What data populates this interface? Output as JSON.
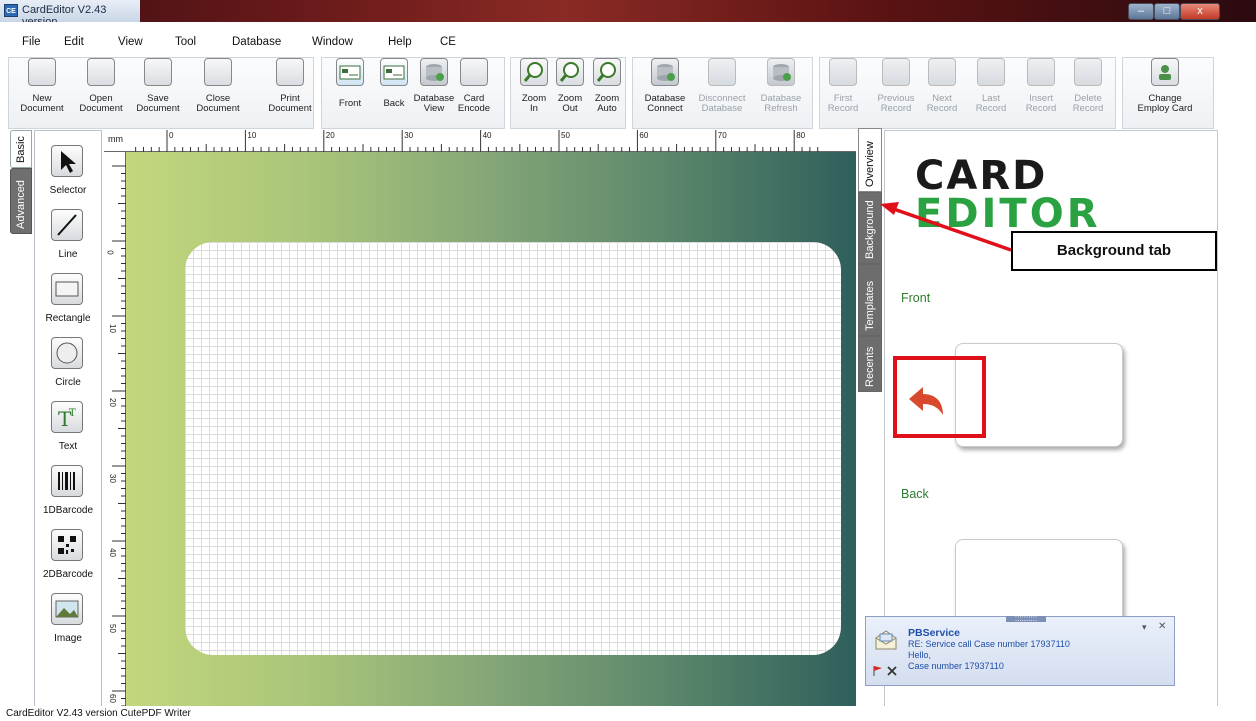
{
  "window": {
    "title": "CardEditor V2.43 version",
    "app_icon": "CE",
    "minimize": "–",
    "maximize": "□",
    "close": "x"
  },
  "menu": [
    "File",
    "Edit",
    "View",
    "Tool",
    "Database",
    "Window",
    "Help",
    "CE"
  ],
  "toolbar": [
    {
      "icon": "new-document-icon",
      "l1": "New",
      "l2": "Document",
      "enabled": true
    },
    {
      "icon": "open-document-icon",
      "l1": "Open",
      "l2": "Document",
      "enabled": true
    },
    {
      "icon": "save-document-icon",
      "l1": "Save",
      "l2": "Document",
      "enabled": true
    },
    {
      "icon": "close-document-icon",
      "l1": "Close",
      "l2": "Document",
      "enabled": true
    },
    {
      "icon": "print-document-icon",
      "l1": "Print",
      "l2": "Document",
      "enabled": true
    },
    {
      "icon": "front-card-icon",
      "l1": "Front",
      "l2": "",
      "enabled": true
    },
    {
      "icon": "back-card-icon",
      "l1": "Back",
      "l2": "",
      "enabled": true
    },
    {
      "icon": "database-view-icon",
      "l1": "Database",
      "l2": "View",
      "enabled": true
    },
    {
      "icon": "card-encode-icon",
      "l1": "Card",
      "l2": "Encode",
      "enabled": true
    },
    {
      "icon": "zoom-in-icon",
      "l1": "Zoom",
      "l2": "In",
      "enabled": true
    },
    {
      "icon": "zoom-out-icon",
      "l1": "Zoom",
      "l2": "Out",
      "enabled": true
    },
    {
      "icon": "zoom-auto-icon",
      "l1": "Zoom",
      "l2": "Auto",
      "enabled": true
    },
    {
      "icon": "database-connect-icon",
      "l1": "Database",
      "l2": "Connect",
      "enabled": true
    },
    {
      "icon": "disconnect-database-icon",
      "l1": "Disconnect",
      "l2": "Database",
      "enabled": false
    },
    {
      "icon": "database-refresh-icon",
      "l1": "Database",
      "l2": "Refresh",
      "enabled": false
    },
    {
      "icon": "first-record-icon",
      "l1": "First",
      "l2": "Record",
      "enabled": false
    },
    {
      "icon": "previous-record-icon",
      "l1": "Previous",
      "l2": "Record",
      "enabled": false
    },
    {
      "icon": "next-record-icon",
      "l1": "Next",
      "l2": "Record",
      "enabled": false
    },
    {
      "icon": "last-record-icon",
      "l1": "Last",
      "l2": "Record",
      "enabled": false
    },
    {
      "icon": "insert-record-icon",
      "l1": "Insert",
      "l2": "Record",
      "enabled": false
    },
    {
      "icon": "delete-record-icon",
      "l1": "Delete",
      "l2": "Record",
      "enabled": false
    },
    {
      "icon": "change-employ-card-icon",
      "l1": "Change",
      "l2": "Employ Card",
      "enabled": true
    }
  ],
  "left_tabs": [
    "Basic",
    "Advanced"
  ],
  "tools": [
    {
      "icon": "selector-icon",
      "label": "Selector"
    },
    {
      "icon": "line-icon",
      "label": "Line"
    },
    {
      "icon": "rectangle-icon",
      "label": "Rectangle"
    },
    {
      "icon": "circle-icon",
      "label": "Circle"
    },
    {
      "icon": "text-icon",
      "label": "Text"
    },
    {
      "icon": "1d-barcode-icon",
      "label": "1DBarcode"
    },
    {
      "icon": "2d-barcode-icon",
      "label": "2DBarcode"
    },
    {
      "icon": "image-icon",
      "label": "Image"
    }
  ],
  "ruler": {
    "unit": "mm",
    "top_labels": [
      "0",
      "10",
      "20",
      "30",
      "40",
      "50",
      "60",
      "70",
      "80"
    ],
    "left_labels": [
      "0",
      "10",
      "20",
      "30",
      "40",
      "50",
      "60"
    ]
  },
  "right_tabs": [
    "Overview",
    "Background",
    "Templates",
    "Recents"
  ],
  "overview": {
    "logo_line1": "CARD",
    "logo_line2": "EDITOR",
    "front_label": "Front",
    "back_label": "Back"
  },
  "annotation": {
    "callout_text": "Background tab",
    "color": "#e0101a"
  },
  "notification": {
    "sender": "PBService",
    "subject": "RE: Service call  Case number 17937110",
    "line1": "Hello,",
    "line2": "Case number 17937110",
    "grip": "::::::::::",
    "dropdown": "▾",
    "close": "✕"
  },
  "status": {
    "text": "CardEditor V2.43 version CutePDF Writer"
  }
}
